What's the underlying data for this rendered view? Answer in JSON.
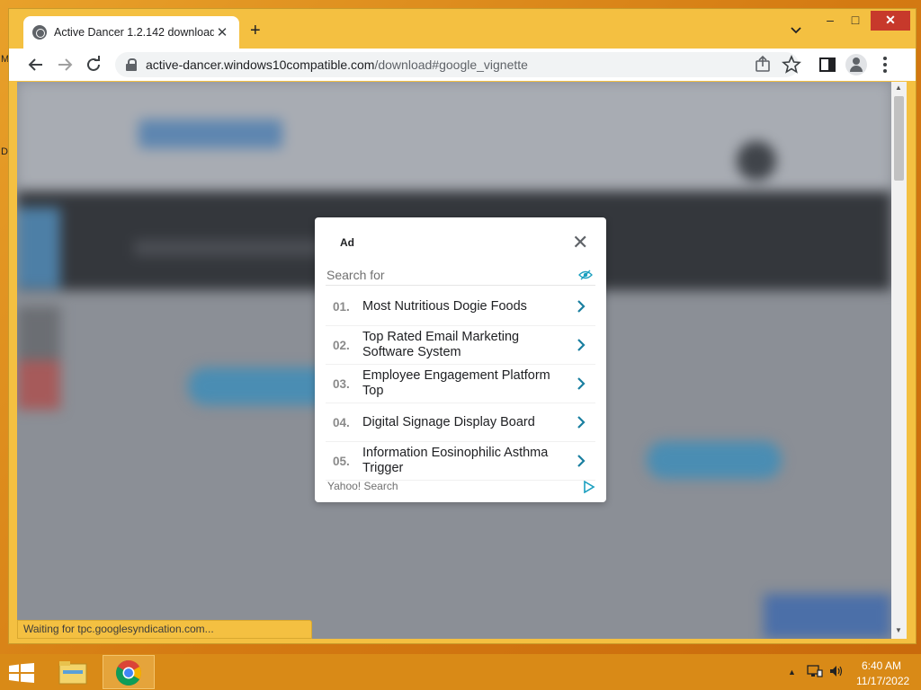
{
  "desktop": {
    "edge_chars": [
      "M",
      "D"
    ]
  },
  "browser": {
    "tab_title": "Active Dancer 1.2.142 download",
    "tab_close": "✕",
    "new_tab": "+",
    "url_host": "active-dancer.windows10compatible.com",
    "url_path": "/download#google_vignette",
    "status_text": "Waiting for tpc.googlesyndication.com..."
  },
  "window_controls": {
    "minimize": "–",
    "maximize": "□",
    "close": "✕"
  },
  "ad": {
    "label": "Ad",
    "close": "✕",
    "search_placeholder": "Search for",
    "results": [
      {
        "num": "01.",
        "text": "Most Nutritious Dogie Foods"
      },
      {
        "num": "02.",
        "text": "Top Rated Email Marketing Software System"
      },
      {
        "num": "03.",
        "text": "Employee Engagement Platform Top"
      },
      {
        "num": "04.",
        "text": "Digital Signage Display Board"
      },
      {
        "num": "05.",
        "text": "Information Eosinophilic Asthma Trigger"
      }
    ],
    "footer": "Yahoo! Search",
    "accent_color": "#1a7fa0"
  },
  "taskbar": {
    "time": "6:40 AM",
    "date": "11/17/2022"
  }
}
